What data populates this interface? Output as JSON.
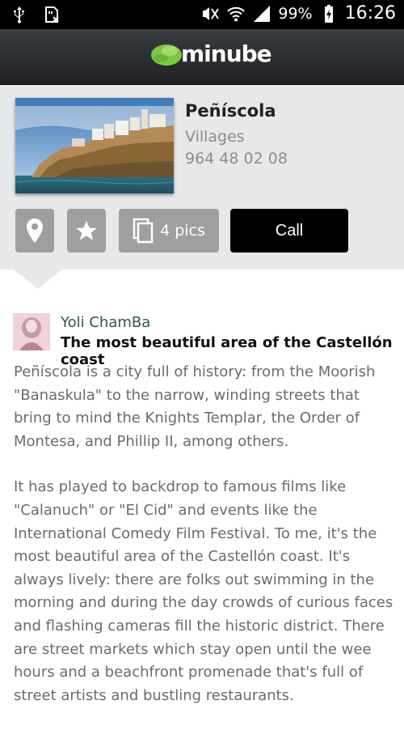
{
  "status_bar": {
    "battery": "99%",
    "time": "16:26",
    "icons": [
      "usb-icon",
      "sd-card-icon",
      "mute-icon",
      "wifi-icon",
      "signal-icon",
      "battery-charging-icon"
    ]
  },
  "app": {
    "logo_text": "minube",
    "brand_color": "#7ac943"
  },
  "place": {
    "name": "Peñíscola",
    "category": "Villages",
    "phone": "964 48 02 08"
  },
  "actions": {
    "location_icon": "map-pin-icon",
    "favorite_icon": "star-icon",
    "pics_label": "4 pics",
    "call_label": "Call"
  },
  "review": {
    "author": "Yoli ChamBa",
    "title": "The most beautiful area of the Castellón coast",
    "paragraphs": [
      "Peñíscola is a city full of history: from the Moorish \"Banaskula\" to the narrow, winding streets that bring to mind the Knights Templar, the Order of Montesa, and Phillip II, among others.",
      "It has played to backdrop to famous films like \"Calanuch\" or \"El Cid\" and events like the International Comedy Film Festival. To me, it's the most beautiful area of the Castellón coast. It's always lively: there are folks out swimming in the morning and during the day crowds of curious faces and flashing cameras fill the historic district. There are street markets which stay open until the wee hours and a beachfront promenade that's full of street artists and bustling restaurants."
    ]
  }
}
